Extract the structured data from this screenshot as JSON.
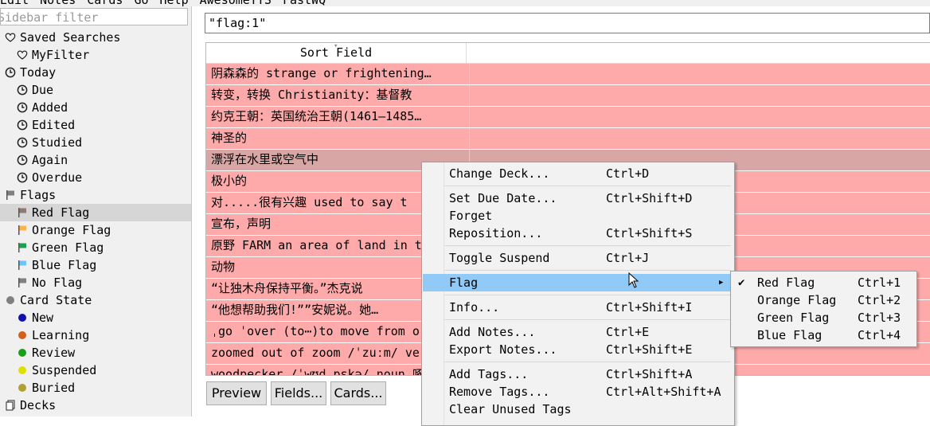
{
  "menubar": [
    "Edit",
    "Notes",
    "Cards",
    "Go",
    "Help",
    "AwesomeTTS",
    "FastWQ"
  ],
  "sidebar": {
    "filter_placeholder": "Sidebar filter",
    "items": [
      {
        "label": "Saved Searches",
        "icon": "heart-icon",
        "level": 0
      },
      {
        "label": "MyFilter",
        "icon": "heart-icon",
        "level": 1
      },
      {
        "label": "Today",
        "icon": "clock-icon",
        "level": 0
      },
      {
        "label": "Due",
        "icon": "clock-icon",
        "level": 1
      },
      {
        "label": "Added",
        "icon": "clock-icon",
        "level": 1
      },
      {
        "label": "Edited",
        "icon": "clock-icon",
        "level": 1
      },
      {
        "label": "Studied",
        "icon": "clock-icon",
        "level": 1
      },
      {
        "label": "Again",
        "icon": "clock-icon",
        "level": 1
      },
      {
        "label": "Overdue",
        "icon": "clock-icon",
        "level": 1
      },
      {
        "label": "Flags",
        "icon": "flag-icon",
        "level": 0,
        "color": "#808080"
      },
      {
        "label": "Red Flag",
        "icon": "flag-icon",
        "level": 1,
        "color": "#8f7a70",
        "selected": true
      },
      {
        "label": "Orange Flag",
        "icon": "flag-icon",
        "level": 1,
        "color": "#ffb347"
      },
      {
        "label": "Green Flag",
        "icon": "flag-icon",
        "level": 1,
        "color": "#1aa34a"
      },
      {
        "label": "Blue Flag",
        "icon": "flag-icon",
        "level": 1,
        "color": "#6cc3ff"
      },
      {
        "label": "No Flag",
        "icon": "flag-icon",
        "level": 1,
        "color": "#808080"
      },
      {
        "label": "Card State",
        "icon": "dot-icon",
        "level": 0,
        "color": "#808080"
      },
      {
        "label": "New",
        "icon": "dot-icon",
        "level": 1,
        "color": "#1010b0"
      },
      {
        "label": "Learning",
        "icon": "dot-icon",
        "level": 1,
        "color": "#d2601a"
      },
      {
        "label": "Review",
        "icon": "dot-icon",
        "level": 1,
        "color": "#18a018"
      },
      {
        "label": "Suspended",
        "icon": "dot-icon",
        "level": 1,
        "color": "#e0e000"
      },
      {
        "label": "Buried",
        "icon": "dot-icon",
        "level": 1,
        "color": "#b0a030"
      },
      {
        "label": "Decks",
        "icon": "decks-icon",
        "level": 0
      }
    ]
  },
  "search": {
    "value": "\"flag:1\""
  },
  "table": {
    "header": "Sort Field",
    "row_color": "#ffaaaa",
    "rows": [
      "阴森森的   strange or frightening…",
      "转变，转换 Christianity：基督教",
      "约克王朝：英国统治王朝(1461—1485…",
      "神圣的",
      "漂浮在水里或空气中",
      "极小的",
      "对.....很有兴趣  used to say t",
      "宣布，声明",
      "原野 FARM an area of land in t",
      "动物",
      "“让独木舟保持平衡。”杰克说",
      "“他想帮助我们!””安妮说。她…",
      "ˌgo ˈover (to⋯)to move from o",
      "zoomed out of  zoom /ˈzuːm/ ve",
      "woodpecker /ˈwʊdˌpɛkə/ noun 啄"
    ],
    "selected_row": 4
  },
  "buttons": {
    "preview": "Preview",
    "fields": "Fields...",
    "cards": "Cards..."
  },
  "context_menu": {
    "items": [
      {
        "label": "Change Deck...",
        "shortcut": "Ctrl+D"
      },
      {
        "label": "Set Due Date...",
        "shortcut": "Ctrl+Shift+D"
      },
      {
        "label": "Forget",
        "shortcut": ""
      },
      {
        "label": "Reposition...",
        "shortcut": "Ctrl+Shift+S"
      },
      {
        "label": "Toggle Suspend",
        "shortcut": "Ctrl+J"
      },
      {
        "label": "Flag",
        "shortcut": "",
        "highlighted": true,
        "submenu": true
      },
      {
        "label": "Info...",
        "shortcut": "Ctrl+Shift+I"
      },
      {
        "label": "Add Notes...",
        "shortcut": "Ctrl+E"
      },
      {
        "label": "Export Notes...",
        "shortcut": "Ctrl+Shift+E"
      },
      {
        "label": "Add Tags...",
        "shortcut": "Ctrl+Shift+A"
      },
      {
        "label": "Remove Tags...",
        "shortcut": "Ctrl+Alt+Shift+A"
      },
      {
        "label": "Clear Unused Tags",
        "shortcut": ""
      }
    ],
    "highlight_color": "#91c9f7"
  },
  "flag_submenu": {
    "items": [
      {
        "label": "Red Flag",
        "shortcut": "Ctrl+1",
        "checked": true
      },
      {
        "label": "Orange Flag",
        "shortcut": "Ctrl+2"
      },
      {
        "label": "Green Flag",
        "shortcut": "Ctrl+3"
      },
      {
        "label": "Blue Flag",
        "shortcut": "Ctrl+4"
      }
    ]
  }
}
